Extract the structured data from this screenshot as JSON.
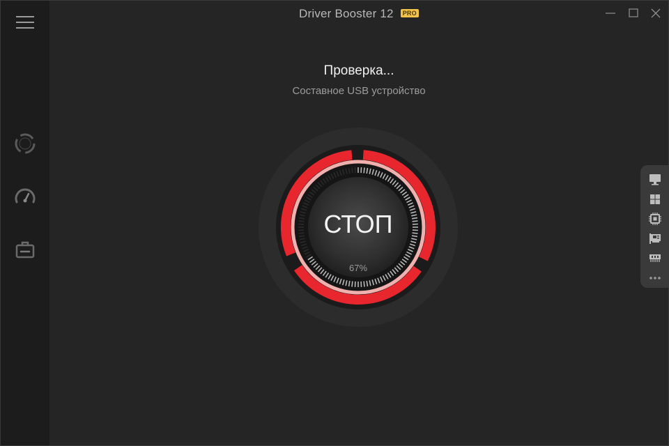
{
  "app": {
    "title": "Driver Booster 12",
    "badge": "PRO"
  },
  "status": {
    "title": "Проверка...",
    "subtitle": "Составное USB устройство"
  },
  "scan": {
    "button_label": "СТОП",
    "progress_label": "67%",
    "progress": 0.67
  },
  "colors": {
    "accent": "#e8262d",
    "accent_light": "#f4b3b0",
    "badge": "#f3c34a"
  },
  "sidebar": {
    "items": [
      {
        "icon": "hamburger-menu-icon"
      },
      {
        "icon": "scan-icon"
      },
      {
        "icon": "speedometer-icon"
      },
      {
        "icon": "toolbox-icon"
      }
    ]
  },
  "right_panel": {
    "items": [
      {
        "icon": "monitor-icon"
      },
      {
        "icon": "windows-icon"
      },
      {
        "icon": "chip-icon"
      },
      {
        "icon": "network-card-icon"
      },
      {
        "icon": "memory-icon"
      },
      {
        "icon": "more-icon"
      }
    ]
  }
}
